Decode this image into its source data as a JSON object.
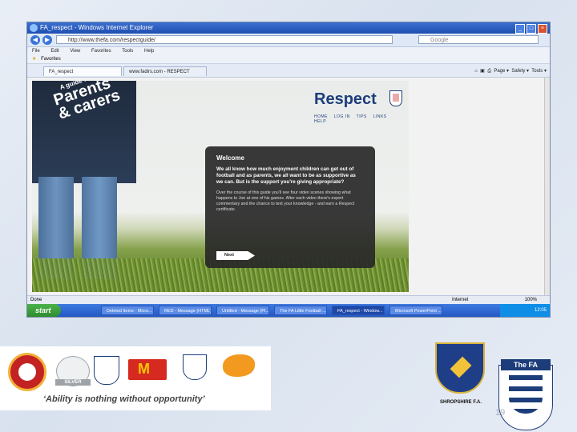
{
  "window": {
    "title": "FA_respect - Windows Internet Explorer",
    "url": "http://www.thefa.com/respectguide/",
    "search_placeholder": "Google",
    "minimize": "_",
    "maximize": "□",
    "close": "×"
  },
  "menu": [
    "File",
    "Edit",
    "View",
    "Favorites",
    "Tools",
    "Help"
  ],
  "favorites_label": "Favorites",
  "tabs": [
    {
      "label": "FA_respect"
    },
    {
      "label": "www.fadirs.com - RESPECT"
    }
  ],
  "commandbar": {
    "items": [
      "Page",
      "Safety",
      "Tools"
    ]
  },
  "page": {
    "hero_prefix": "A guide for",
    "hero_line1": "Parents",
    "hero_line2": "& carers",
    "brand": "Respect",
    "nav": [
      "HOME",
      "LOG IN",
      "TIPS",
      "LINKS",
      "HELP"
    ],
    "welcome": {
      "heading": "Welcome",
      "intro": "We all know how much enjoyment children can get out of football and as parents, we all want to be as supportive as we can. But is the support you're giving appropriate?",
      "body": "Over the course of this guide you'll see four video scenes showing what happens to Joe at one of his games. After each video there's expert commentary and the chance to test your knowledge - and earn a Respect certificate.",
      "next_label": "Next"
    }
  },
  "statusbar": {
    "left": "Done",
    "zone": "Internet",
    "zoom": "100%"
  },
  "taskbar": {
    "start_label": "start",
    "items": [
      "Deleted Items - Micro...",
      "RED - Message (HTML)",
      "Untitled - Message (Pl...",
      "The FA Little Football ...",
      "FA_respect - Window...",
      "Microsoft PowerPoint ..."
    ],
    "clock": "12:05"
  },
  "footer": {
    "tagline": "‘Ability is nothing without opportunity’",
    "silver_word": "SILVER",
    "shropshire": "SHROPSHIRE F.A.",
    "the_fa": "The FA"
  },
  "page_number": "19"
}
